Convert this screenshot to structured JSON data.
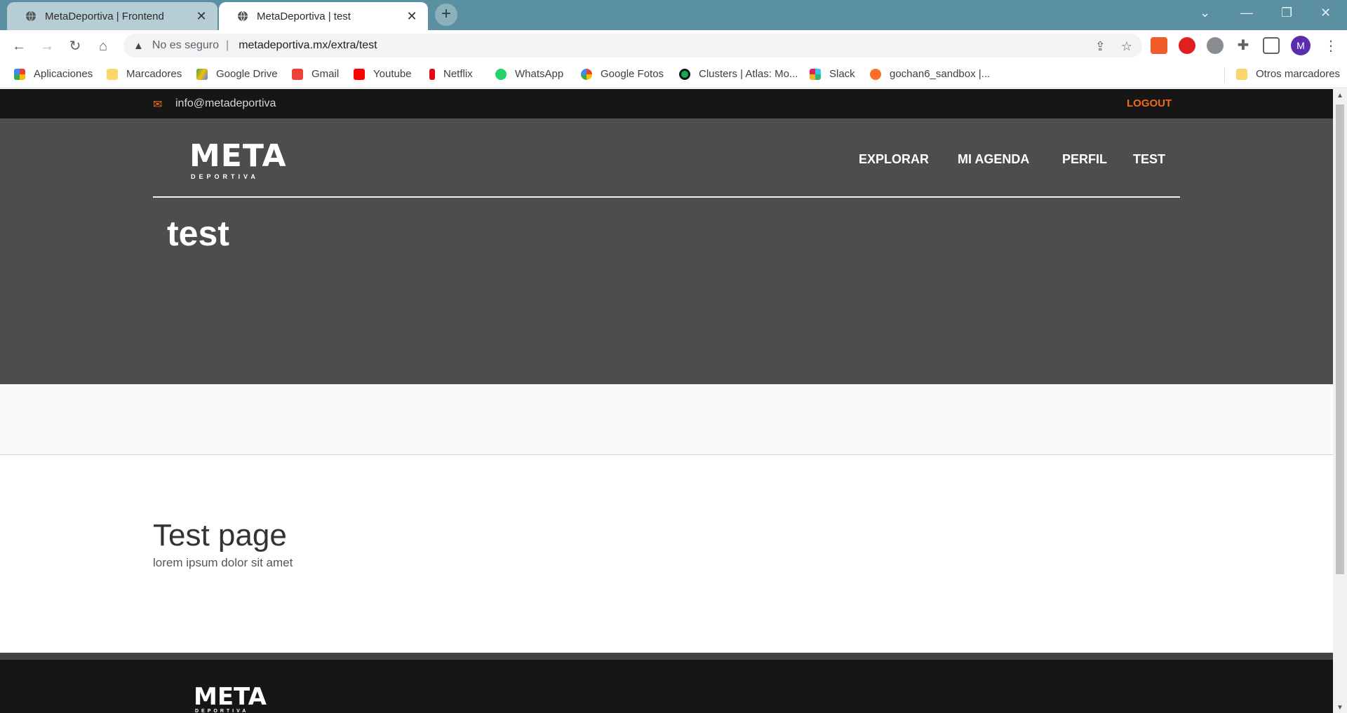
{
  "browser": {
    "tabs": [
      {
        "title": "MetaDeportiva | Frontend"
      },
      {
        "title": "MetaDeportiva | test"
      }
    ],
    "new_tab": "+",
    "address": {
      "security": "No es seguro",
      "url": "metadeportiva.mx/extra/test"
    },
    "profile_initial": "M",
    "bookmarks": [
      "Aplicaciones",
      "Marcadores",
      "Google Drive",
      "Gmail",
      "Youtube",
      "Netflix",
      "WhatsApp",
      "Google Fotos",
      "Clusters | Atlas: Mo...",
      "Slack",
      "gochan6_sandbox |...",
      "Otros marcadores"
    ]
  },
  "site": {
    "contact_email": "info@metadeportiva",
    "logout": "LOGOUT",
    "logo_text": "META",
    "logo_sub": "DEPORTIVA",
    "nav": [
      "EXPLORAR",
      "MI AGENDA",
      "PERFIL",
      "TEST"
    ],
    "hero_title": "test",
    "content_title": "Test page",
    "content_text": "lorem ipsum dolor sit amet"
  },
  "colors": {
    "accent": "#f26a1b",
    "hero_bg": "#4d4d4d",
    "topbar_bg": "#161616",
    "tabstrip": "#5b8fa2"
  }
}
